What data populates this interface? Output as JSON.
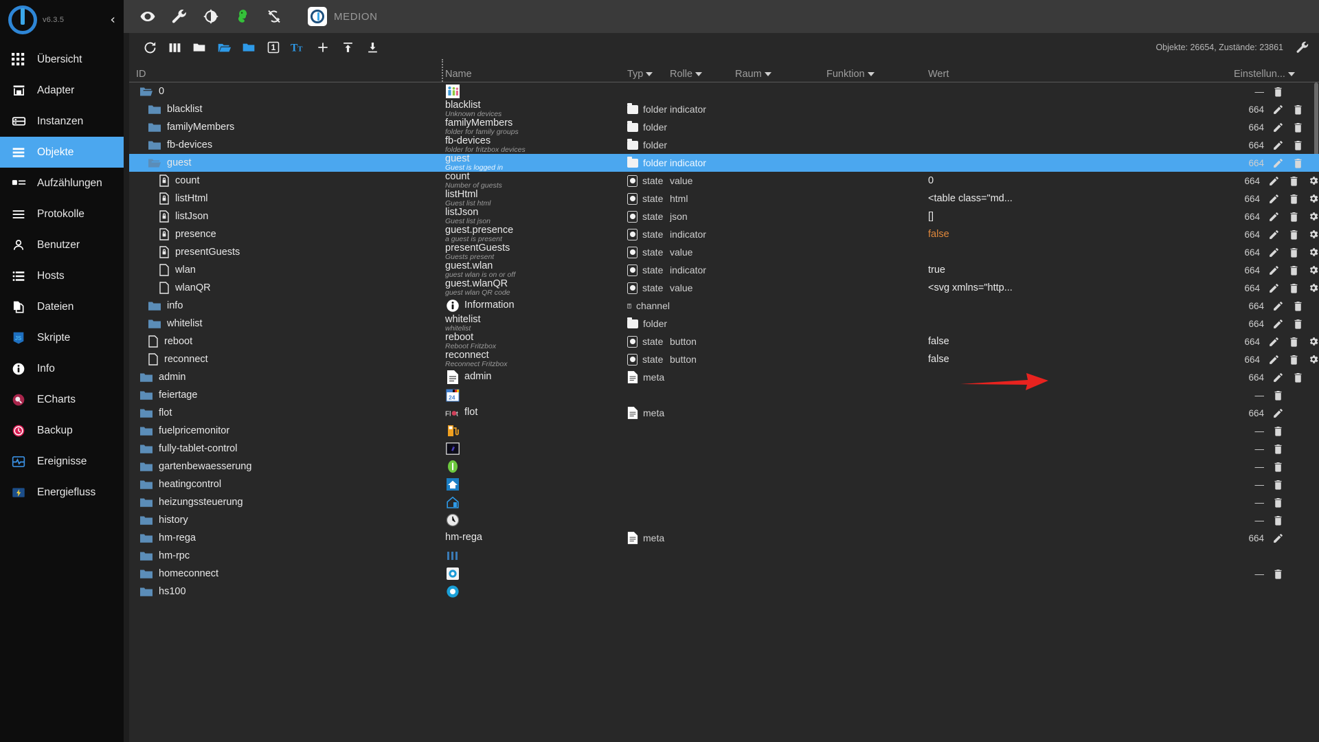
{
  "sidebar": {
    "version": "v6.3.5",
    "collapse_label": "‹",
    "items": [
      {
        "label": "Übersicht",
        "icon": "grid-icon",
        "active": false
      },
      {
        "label": "Adapter",
        "icon": "store-icon",
        "active": false
      },
      {
        "label": "Instanzen",
        "icon": "instances-icon",
        "active": false
      },
      {
        "label": "Objekte",
        "icon": "list-icon",
        "active": true
      },
      {
        "label": "Aufzählungen",
        "icon": "enum-icon",
        "active": false
      },
      {
        "label": "Protokolle",
        "icon": "log-icon",
        "active": false
      },
      {
        "label": "Benutzer",
        "icon": "user-icon",
        "active": false
      },
      {
        "label": "Hosts",
        "icon": "hosts-icon",
        "active": false
      },
      {
        "label": "Dateien",
        "icon": "files-icon",
        "active": false
      },
      {
        "label": "Skripte",
        "icon": "javascript-icon",
        "active": false
      },
      {
        "label": "Info",
        "icon": "info-icon",
        "active": false
      },
      {
        "label": "ECharts",
        "icon": "echarts-icon",
        "active": false
      },
      {
        "label": "Backup",
        "icon": "backup-icon",
        "active": false
      },
      {
        "label": "Ereignisse",
        "icon": "events-icon",
        "active": false
      },
      {
        "label": "Energiefluss",
        "icon": "energy-icon",
        "active": false
      }
    ]
  },
  "topbar": {
    "icons": [
      "eye-icon",
      "wrench-icon",
      "contrast-icon",
      "mascot-icon",
      "no-sync-icon"
    ],
    "host_name": "MEDION"
  },
  "toolbar": {
    "icons": [
      "refresh-icon",
      "columns-icon",
      "folder-white-icon",
      "folder-open-blue-icon",
      "folder-blue-icon",
      "expand-level-1-icon",
      "text-size-icon",
      "plus-icon",
      "upload-icon",
      "download-icon"
    ],
    "expand_level": "1",
    "object_counts": "Objekte: 26654, Zustände: 23861",
    "settings_icon": "wrench-icon"
  },
  "table": {
    "headers": {
      "id": "ID",
      "name": "Name",
      "typ": "Typ",
      "rolle": "Rolle",
      "raum": "Raum",
      "funktion": "Funktion",
      "wert": "Wert",
      "einstellungen": "Einstellun..."
    },
    "rows": [
      {
        "id": "0",
        "indent": 0,
        "icon": "folder-open",
        "name": "",
        "desc": "",
        "name_icon": "family-icon",
        "typ": "",
        "rolle": "",
        "raum": "",
        "funktion": "",
        "wert": "",
        "acl": "—",
        "actions": [
          "trash"
        ],
        "selected": false
      },
      {
        "id": "blacklist",
        "indent": 1,
        "icon": "folder",
        "name": "blacklist",
        "desc": "Unknown devices",
        "typ": "folder",
        "rolle": "indicator",
        "raum": "",
        "funktion": "",
        "wert": "",
        "acl": "664",
        "actions": [
          "pencil",
          "trash"
        ],
        "selected": false
      },
      {
        "id": "familyMembers",
        "indent": 1,
        "icon": "folder",
        "name": "familyMembers",
        "desc": "folder for family groups",
        "typ": "folder",
        "rolle": "",
        "raum": "",
        "funktion": "",
        "wert": "",
        "acl": "664",
        "actions": [
          "pencil",
          "trash"
        ],
        "selected": false
      },
      {
        "id": "fb-devices",
        "indent": 1,
        "icon": "folder",
        "name": "fb-devices",
        "desc": "folder for fritzbox devices",
        "typ": "folder",
        "rolle": "",
        "raum": "",
        "funktion": "",
        "wert": "",
        "acl": "664",
        "actions": [
          "pencil",
          "trash"
        ],
        "selected": false
      },
      {
        "id": "guest",
        "indent": 1,
        "icon": "folder-open",
        "name": "guest",
        "desc": "Guest is logged in",
        "typ": "folder",
        "rolle": "indicator",
        "raum": "",
        "funktion": "",
        "wert": "",
        "acl": "664",
        "actions": [
          "pencil",
          "trash"
        ],
        "selected": true
      },
      {
        "id": "count",
        "indent": 2,
        "icon": "state-file",
        "name": "count",
        "desc": "Number of guests",
        "typ": "state",
        "rolle": "value",
        "raum": "",
        "funktion": "",
        "wert": "0",
        "wert_style": "white",
        "acl": "664",
        "actions": [
          "pencil",
          "trash",
          "gear"
        ],
        "selected": false
      },
      {
        "id": "listHtml",
        "indent": 2,
        "icon": "state-file",
        "name": "listHtml",
        "desc": "Guest list html",
        "typ": "state",
        "rolle": "html",
        "raum": "",
        "funktion": "",
        "wert": "<table class=\"md...",
        "wert_style": "white",
        "acl": "664",
        "actions": [
          "pencil",
          "trash",
          "gear"
        ],
        "selected": false
      },
      {
        "id": "listJson",
        "indent": 2,
        "icon": "state-file",
        "name": "listJson",
        "desc": "Guest list json",
        "typ": "state",
        "rolle": "json",
        "raum": "",
        "funktion": "",
        "wert": "[]",
        "wert_style": "white",
        "acl": "664",
        "actions": [
          "pencil",
          "trash",
          "gear"
        ],
        "selected": false
      },
      {
        "id": "presence",
        "indent": 2,
        "icon": "state-file",
        "name": "guest.presence",
        "desc": "a guest is present",
        "typ": "state",
        "rolle": "indicator",
        "raum": "",
        "funktion": "",
        "wert": "false",
        "wert_style": "orange",
        "acl": "664",
        "actions": [
          "pencil",
          "trash",
          "gear"
        ],
        "selected": false
      },
      {
        "id": "presentGuests",
        "indent": 2,
        "icon": "state-file",
        "name": "presentGuests",
        "desc": "Guests present",
        "typ": "state",
        "rolle": "value",
        "raum": "",
        "funktion": "",
        "wert": "",
        "acl": "664",
        "actions": [
          "pencil",
          "trash",
          "gear"
        ],
        "selected": false
      },
      {
        "id": "wlan",
        "indent": 2,
        "icon": "file",
        "name": "guest.wlan",
        "desc": "guest wlan is on or off",
        "typ": "state",
        "rolle": "indicator",
        "raum": "",
        "funktion": "",
        "wert": "true",
        "wert_style": "white",
        "acl": "664",
        "actions": [
          "pencil",
          "trash",
          "gear"
        ],
        "selected": false
      },
      {
        "id": "wlanQR",
        "indent": 2,
        "icon": "file",
        "name": "guest.wlanQR",
        "desc": "guest wlan QR code",
        "typ": "state",
        "rolle": "value",
        "raum": "",
        "funktion": "",
        "wert": "<svg xmlns=\"http...",
        "wert_style": "white",
        "acl": "664",
        "actions": [
          "pencil",
          "trash",
          "gear"
        ],
        "selected": false
      },
      {
        "id": "info",
        "indent": 1,
        "icon": "folder",
        "name": "Information",
        "desc": "",
        "name_icon": "info-circle-icon",
        "typ": "channel",
        "rolle": "",
        "raum": "",
        "funktion": "",
        "wert": "",
        "acl": "664",
        "actions": [
          "pencil",
          "trash"
        ],
        "selected": false
      },
      {
        "id": "whitelist",
        "indent": 1,
        "icon": "folder",
        "name": "whitelist",
        "desc": "whitelist",
        "typ": "folder",
        "rolle": "",
        "raum": "",
        "funktion": "",
        "wert": "",
        "acl": "664",
        "actions": [
          "pencil",
          "trash"
        ],
        "selected": false
      },
      {
        "id": "reboot",
        "indent": 1,
        "icon": "file",
        "name": "reboot",
        "desc": "Reboot Fritzbox",
        "typ": "state",
        "rolle": "button",
        "raum": "",
        "funktion": "",
        "wert": "false",
        "wert_style": "white",
        "acl": "664",
        "actions": [
          "pencil",
          "trash",
          "gear"
        ],
        "selected": false
      },
      {
        "id": "reconnect",
        "indent": 1,
        "icon": "file",
        "name": "reconnect",
        "desc": "Reconnect Fritzbox",
        "typ": "state",
        "rolle": "button",
        "raum": "",
        "funktion": "",
        "wert": "false",
        "wert_style": "white",
        "acl": "664",
        "actions": [
          "pencil",
          "trash",
          "gear"
        ],
        "selected": false
      },
      {
        "id": "admin",
        "indent": 0,
        "icon": "folder",
        "name": "admin",
        "desc": "",
        "name_icon": "doc-icon",
        "typ": "meta",
        "typ_icon": "doc",
        "rolle": "",
        "raum": "",
        "funktion": "",
        "wert": "",
        "acl": "664",
        "actions": [
          "pencil",
          "trash"
        ],
        "selected": false
      },
      {
        "id": "feiertage",
        "indent": -1,
        "icon": "folder",
        "name": "",
        "desc": "",
        "name_icon": "calendar-icon",
        "typ": "",
        "rolle": "",
        "raum": "",
        "funktion": "",
        "wert": "",
        "acl": "—",
        "actions": [
          "trash"
        ],
        "selected": false
      },
      {
        "id": "flot",
        "indent": -1,
        "icon": "folder",
        "name": "flot",
        "desc": "",
        "name_icon": "flot-icon",
        "typ": "meta",
        "typ_icon": "doc",
        "rolle": "",
        "raum": "",
        "funktion": "",
        "wert": "",
        "acl": "664",
        "actions": [
          "pencil"
        ],
        "selected": false
      },
      {
        "id": "fuelpricemonitor",
        "indent": -1,
        "icon": "folder",
        "name": "",
        "desc": "",
        "name_icon": "fuel-icon",
        "typ": "",
        "rolle": "",
        "raum": "",
        "funktion": "",
        "wert": "",
        "acl": "—",
        "actions": [
          "trash"
        ],
        "selected": false
      },
      {
        "id": "fully-tablet-control",
        "indent": -1,
        "icon": "folder",
        "name": "",
        "desc": "",
        "name_icon": "tablet-icon",
        "typ": "",
        "rolle": "",
        "raum": "",
        "funktion": "",
        "wert": "",
        "acl": "—",
        "actions": [
          "trash"
        ],
        "selected": false
      },
      {
        "id": "gartenbewaesserung",
        "indent": -1,
        "icon": "folder",
        "name": "",
        "desc": "",
        "name_icon": "sprinkler-icon",
        "typ": "",
        "rolle": "",
        "raum": "",
        "funktion": "",
        "wert": "",
        "acl": "—",
        "actions": [
          "trash"
        ],
        "selected": false
      },
      {
        "id": "heatingcontrol",
        "indent": -1,
        "icon": "folder",
        "name": "",
        "desc": "",
        "name_icon": "house-blue-icon",
        "typ": "",
        "rolle": "",
        "raum": "",
        "funktion": "",
        "wert": "",
        "acl": "—",
        "actions": [
          "trash"
        ],
        "selected": false
      },
      {
        "id": "heizungssteuerung",
        "indent": -1,
        "icon": "folder",
        "name": "",
        "desc": "",
        "name_icon": "house-outline-icon",
        "typ": "",
        "rolle": "",
        "raum": "",
        "funktion": "",
        "wert": "",
        "acl": "—",
        "actions": [
          "trash"
        ],
        "selected": false
      },
      {
        "id": "history",
        "indent": -1,
        "icon": "folder",
        "name": "",
        "desc": "",
        "name_icon": "clock-icon",
        "typ": "",
        "rolle": "",
        "raum": "",
        "funktion": "",
        "wert": "",
        "acl": "—",
        "actions": [
          "trash"
        ],
        "selected": false
      },
      {
        "id": "hm-rega",
        "indent": -1,
        "icon": "folder",
        "name": "hm-rega",
        "desc": "",
        "typ": "meta",
        "typ_icon": "doc",
        "rolle": "",
        "raum": "",
        "funktion": "",
        "wert": "",
        "acl": "664",
        "actions": [
          "pencil"
        ],
        "selected": false
      },
      {
        "id": "hm-rpc",
        "indent": -1,
        "icon": "folder",
        "name": "",
        "desc": "",
        "name_icon": "hmrpc-icon",
        "typ": "",
        "rolle": "",
        "raum": "",
        "funktion": "",
        "wert": "",
        "acl": "",
        "actions": [],
        "selected": false
      },
      {
        "id": "homeconnect",
        "indent": -1,
        "icon": "folder",
        "name": "",
        "desc": "",
        "name_icon": "homeconnect-icon",
        "typ": "",
        "rolle": "",
        "raum": "",
        "funktion": "",
        "wert": "",
        "acl": "—",
        "actions": [
          "trash"
        ],
        "selected": false
      },
      {
        "id": "hs100",
        "indent": -1,
        "icon": "folder",
        "name": "",
        "desc": "",
        "name_icon": "hs100-icon",
        "typ": "",
        "rolle": "",
        "raum": "",
        "funktion": "",
        "wert": "",
        "acl": "",
        "actions": [],
        "selected": false
      }
    ]
  },
  "annotation": {
    "arrow_color": "#e8231f",
    "type": "red-arrow-pointing-right"
  }
}
